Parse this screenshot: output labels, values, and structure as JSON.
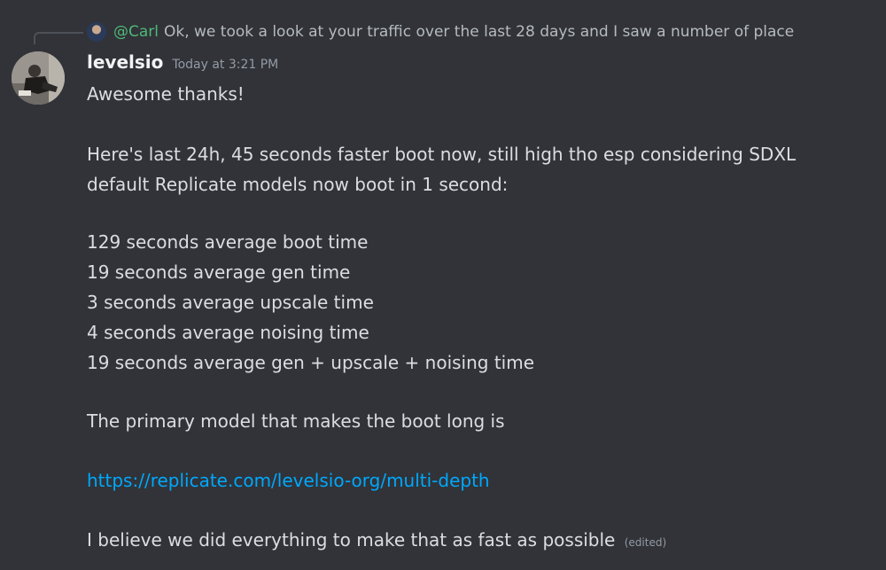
{
  "reply": {
    "author": "@Carl",
    "preview": "Ok, we took a look at your traffic over the last 28 days and I saw a number of place"
  },
  "message": {
    "username": "levelsio",
    "timestamp": "Today at 3:21 PM",
    "lines": [
      "Awesome thanks!",
      "Here's last 24h, 45 seconds faster boot now, still high tho esp considering SDXL",
      "default Replicate models now boot in 1 second:",
      "129 seconds average boot time",
      "19 seconds average gen time",
      "3 seconds average upscale time",
      "4 seconds average noising time",
      "19 seconds average gen + upscale + noising time",
      "The primary model that makes the boot long is",
      "I believe we did everything to make that as fast as possible"
    ],
    "link": "https://replicate.com/levelsio-org/multi-depth",
    "edited_label": "(edited)"
  },
  "colors": {
    "background": "#313338",
    "reply_author": "#4fb878",
    "link": "#00a8fc",
    "username": "#f2f3f5",
    "muted": "#949ba4"
  }
}
